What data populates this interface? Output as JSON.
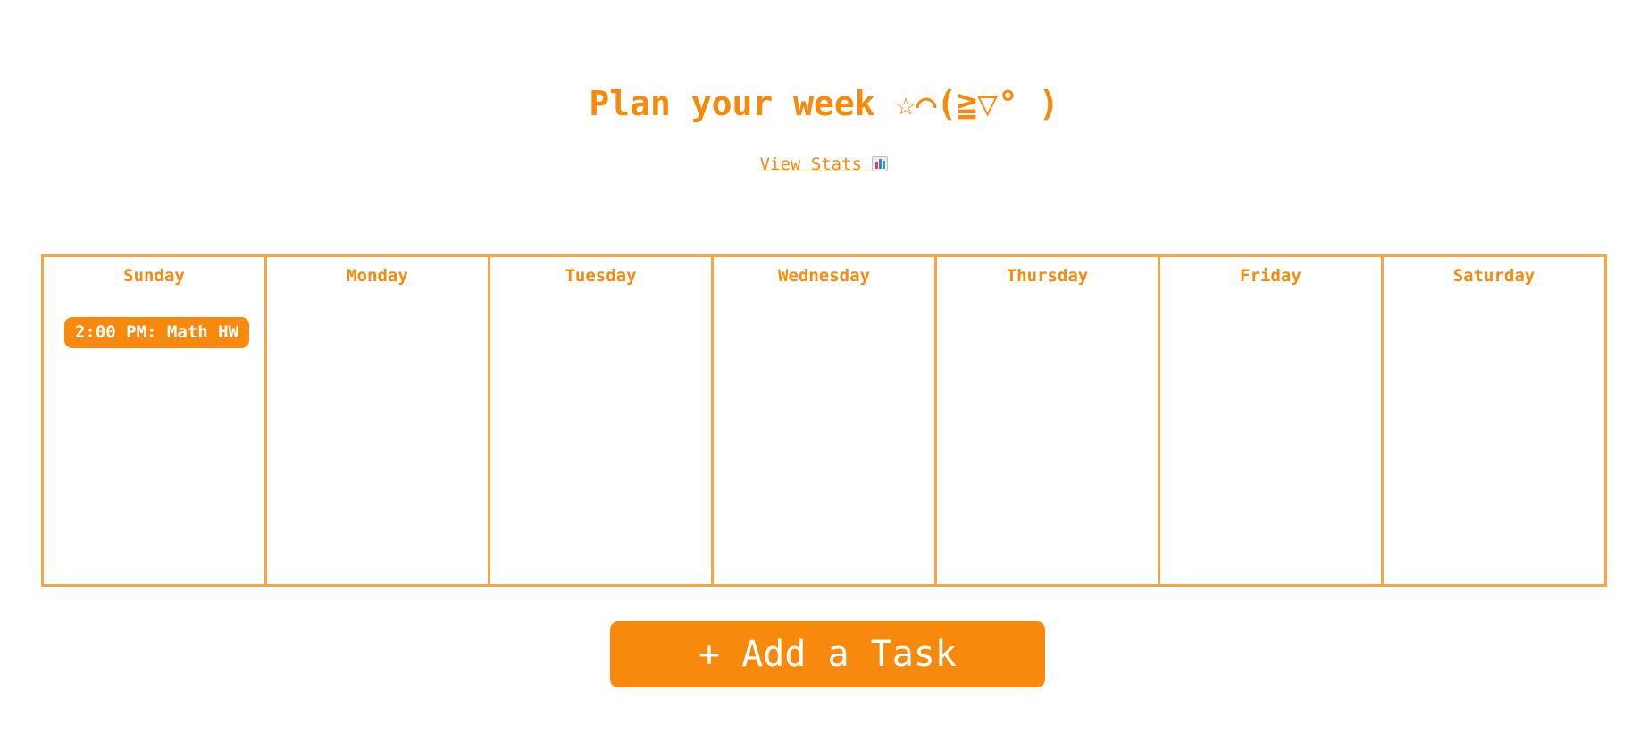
{
  "header": {
    "title": "Plan your week ☆⌒(≧▽° )",
    "stats_link_label": "View Stats ",
    "stats_icon": "bar-chart-icon"
  },
  "week": {
    "days": [
      {
        "name": "Sunday",
        "tasks": [
          "2:00 PM: Math HW"
        ]
      },
      {
        "name": "Monday",
        "tasks": []
      },
      {
        "name": "Tuesday",
        "tasks": []
      },
      {
        "name": "Wednesday",
        "tasks": []
      },
      {
        "name": "Thursday",
        "tasks": []
      },
      {
        "name": "Friday",
        "tasks": []
      },
      {
        "name": "Saturday",
        "tasks": []
      }
    ]
  },
  "actions": {
    "add_task_label": "+ Add a Task"
  },
  "colors": {
    "accent": "#f78a0c",
    "border": "#f7a646",
    "background": "#ffffff"
  }
}
